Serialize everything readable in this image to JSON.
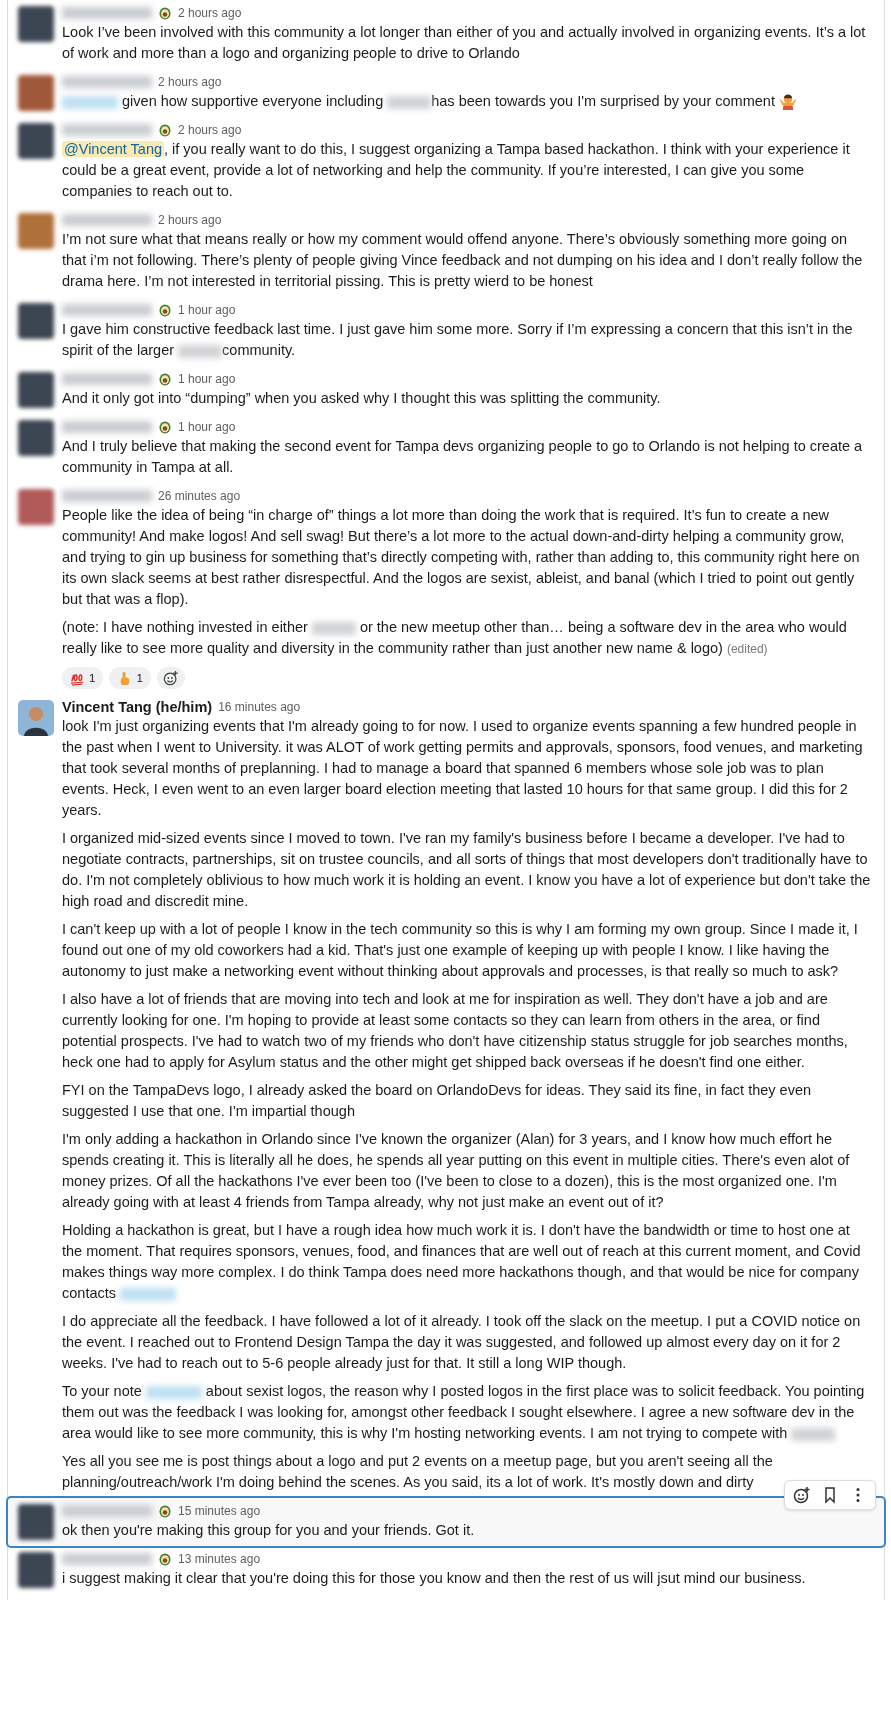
{
  "messages": [
    {
      "avatar": {
        "kind": "blurred",
        "color": "#3c4552"
      },
      "name_blurred": true,
      "status_emoji": true,
      "time": "2 hours ago",
      "highlighted": false,
      "paragraphs": [
        [
          {
            "kind": "text",
            "text": "Look I’ve been involved with this community a lot longer than either of you and actually involved in organizing events.  It’s a lot of work and more than a logo and organizing people to drive to Orlando"
          }
        ]
      ]
    },
    {
      "avatar": {
        "kind": "blurred",
        "color": "#a0583a"
      },
      "name_blurred": true,
      "status_emoji": false,
      "time": "2 hours ago",
      "highlighted": false,
      "paragraphs": [
        [
          {
            "kind": "blurred_mention"
          },
          {
            "kind": "text",
            "text": " given how supportive everyone including "
          },
          {
            "kind": "blurred"
          },
          {
            "kind": "text",
            "text": "has been towards you I'm surprised by your comment "
          },
          {
            "kind": "shrug_emoji"
          }
        ]
      ]
    },
    {
      "avatar": {
        "kind": "blurred",
        "color": "#3c4552"
      },
      "name_blurred": true,
      "status_emoji": true,
      "time": "2 hours ago",
      "highlighted": false,
      "paragraphs": [
        [
          {
            "kind": "mention",
            "text": "@Vincent Tang"
          },
          {
            "kind": "text",
            "text": ", if you really want to do this, I suggest organizing a Tampa based hackathon.  I think with your experience it could be a great event, provide a lot of networking and help the community.  If you’re interested, I can give you some companies to reach out to."
          }
        ]
      ]
    },
    {
      "avatar": {
        "kind": "blurred",
        "color": "#b0703a"
      },
      "name_blurred": true,
      "status_emoji": false,
      "time": "2 hours ago",
      "highlighted": false,
      "paragraphs": [
        [
          {
            "kind": "text",
            "text": "I’m not sure what that means really or how my comment would offend anyone. There’s obviously something more going on that i’m not following. There’s plenty of people giving Vince feedback and not dumping on his idea and I don’t really follow the drama here. I’m not interested in territorial pissing. This is pretty wierd to be honest"
          }
        ]
      ]
    },
    {
      "avatar": {
        "kind": "blurred",
        "color": "#3c4552"
      },
      "name_blurred": true,
      "status_emoji": true,
      "time": "1 hour ago",
      "highlighted": false,
      "paragraphs": [
        [
          {
            "kind": "text",
            "text": "I gave him constructive feedback last time. I just gave him some more.  Sorry if I’m expressing a concern that this isn’t in the spirit of the larger "
          },
          {
            "kind": "blurred"
          },
          {
            "kind": "text",
            "text": "community."
          }
        ]
      ]
    },
    {
      "avatar": {
        "kind": "blurred",
        "color": "#3c4552"
      },
      "name_blurred": true,
      "status_emoji": true,
      "time": "1 hour ago",
      "highlighted": false,
      "paragraphs": [
        [
          {
            "kind": "text",
            "text": "And it only got into “dumping” when you asked why I thought this was splitting the community."
          }
        ]
      ]
    },
    {
      "avatar": {
        "kind": "blurred",
        "color": "#3c4552"
      },
      "name_blurred": true,
      "status_emoji": true,
      "time": "1 hour ago",
      "highlighted": false,
      "paragraphs": [
        [
          {
            "kind": "text",
            "text": "And I truly believe that making the second event for Tampa devs organizing people to go to Orlando is not helping to create a community in Tampa at all."
          }
        ]
      ]
    },
    {
      "avatar": {
        "kind": "blurred",
        "color": "#b05a5a"
      },
      "name_blurred": true,
      "status_emoji": false,
      "time": "26 minutes ago",
      "highlighted": false,
      "paragraphs": [
        [
          {
            "kind": "text",
            "text": "People like the idea of being “in charge of” things a lot more than doing the work that is required. It’s fun to create a new community! And make logos! And sell swag! But there’s a lot more to the actual down-and-dirty helping a community grow, and trying to gin up business for something that’s directly competing with, rather than adding to, this community right here on its own slack seems at best rather disrespectful. And the logos are sexist, ableist, and banal (which I tried to point out gently but that was a flop)."
          }
        ],
        [
          {
            "kind": "text",
            "text": "(note: I have nothing invested in either "
          },
          {
            "kind": "blurred"
          },
          {
            "kind": "text",
            "text": " or the new meetup other than… being a software dev in the area who would really like to see more quality and diversity in the community rather than just another new name & logo) "
          },
          {
            "kind": "edited",
            "text": "(edited)"
          }
        ]
      ],
      "reactions": [
        {
          "kind": "hundred",
          "count": "1"
        },
        {
          "kind": "point_up",
          "count": "1"
        }
      ]
    },
    {
      "avatar": {
        "kind": "person"
      },
      "name": "Vincent Tang (he/him)",
      "status_emoji": false,
      "time": "16 minutes ago",
      "highlighted": false,
      "paragraphs": [
        [
          {
            "kind": "text",
            "text": "look I'm just organizing events that I'm already going to for now. I used to organize events spanning a few hundred people in the past when I went to University. it was ALOT of work getting permits and approvals, sponsors, food venues, and marketing that took several months of preplanning. I had to manage a board that spanned 6 members whose sole job was to plan events. Heck, I even went to an even larger board election meeting that lasted 10 hours for that same group. I did this for 2 years."
          }
        ],
        [
          {
            "kind": "text",
            "text": "I organized mid-sized events since I moved to town. I've ran my family's business before I became a developer. I've had to negotiate contracts, partnerships, sit on trustee councils, and all sorts of things that most developers don't traditionally have to do. I'm not completely oblivious to how much work it is holding an event. I know you have a lot of experience but don't take the high road and discredit mine."
          }
        ],
        [
          {
            "kind": "text",
            "text": "I can't keep up with a lot of people I know in the tech community so this is why I am forming my own group. Since I made it, I found out one of my old coworkers had a kid. That's just one example of keeping up with people I know. I like having the autonomy to just make a networking event without thinking about approvals and processes, is that really so much to ask?"
          }
        ],
        [
          {
            "kind": "text",
            "text": "I also have a lot of friends that are moving into tech and look at me for inspiration as well. They don't have a job and are currently looking for one. I'm hoping to provide at least some contacts so they can learn from others in the area, or find potential prospects. I've had to watch two of my friends who don't have citizenship status struggle for job searches months, heck one had to apply for Asylum status and the other might get shipped back overseas if he doesn't find one either."
          }
        ],
        [
          {
            "kind": "text",
            "text": "FYI on the TampaDevs logo, I already asked the board on OrlandoDevs for ideas. They said its fine, in fact they even suggested I use that one. I'm impartial though"
          }
        ],
        [
          {
            "kind": "text",
            "text": "I'm only adding a hackathon in Orlando since I've known the organizer (Alan) for 3 years, and I know how much effort he spends creating it. This is literally all he does, he spends all year putting on this event in multiple cities. There's even alot of money prizes. Of all the hackathons I've ever been too (I've been to close to a dozen), this is the most organized one. I'm already going with at least 4 friends from Tampa already, why not just make an event out of it?"
          }
        ],
        [
          {
            "kind": "text",
            "text": "Holding a hackathon is great, but I have a rough idea how much work it is. I don't have the bandwidth or time to host one at the moment. That requires sponsors, venues, food, and finances that are well out of reach at this current moment, and Covid makes things way more complex. I do think Tampa does need more hackathons though, and that would be nice for company contacts "
          },
          {
            "kind": "blurred_mention"
          }
        ],
        [
          {
            "kind": "text",
            "text": "I do appreciate all the feedback. I have followed a lot of it already. I took off the slack on the meetup. I put a COVID notice on the event. I reached out to Frontend Design Tampa the day it was suggested, and followed up almost every day on it for 2 weeks. I've had to reach out to 5-6 people already just for that. It still a long WIP though."
          }
        ],
        [
          {
            "kind": "text",
            "text": "To your note "
          },
          {
            "kind": "blurred_mention"
          },
          {
            "kind": "text",
            "text": " about sexist logos, the reason why I posted logos in the first place was to solicit feedback. You pointing them out was the feedback I was looking for, amongst other feedback I sought elsewhere. I agree a new software dev in the area would like to see more community, this is why I'm hosting networking events. I am not trying to compete with "
          },
          {
            "kind": "blurred"
          }
        ],
        [
          {
            "kind": "text",
            "text": "Yes all you see me is post things about a logo and put 2 events on a meetup page, but you aren't seeing all the planning/outreach/work I'm doing behind the scenes. As you said, its a lot of work. It's mostly down and dirty"
          }
        ]
      ]
    },
    {
      "avatar": {
        "kind": "blurred",
        "color": "#3c4552"
      },
      "name_blurred": true,
      "status_emoji": true,
      "time": "15 minutes ago",
      "highlighted": true,
      "paragraphs": [
        [
          {
            "kind": "text",
            "text": "ok then you're making this group for you and your friends.  Got it."
          }
        ]
      ]
    },
    {
      "avatar": {
        "kind": "blurred",
        "color": "#3c4552"
      },
      "name_blurred": true,
      "status_emoji": true,
      "time": "13 minutes ago",
      "highlighted": false,
      "paragraphs": [
        [
          {
            "kind": "text",
            "text": "i suggest making it clear that you're doing this for those you know and then the rest of us will jsut mind our business."
          }
        ]
      ]
    }
  ]
}
